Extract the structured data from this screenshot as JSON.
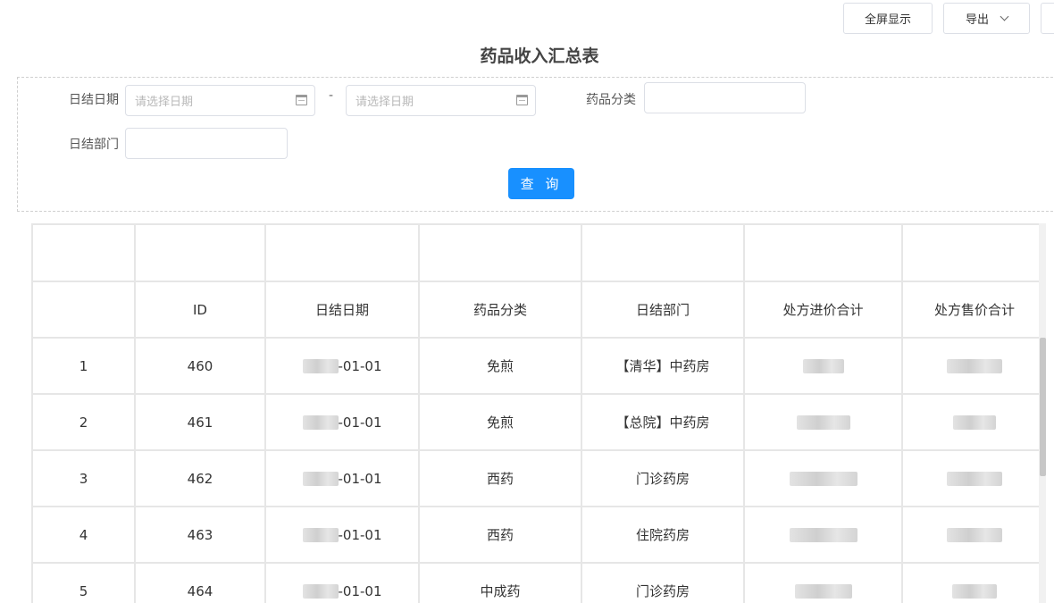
{
  "toolbar": {
    "fullscreen_label": "全屏显示",
    "export_label": "导出"
  },
  "title": "药品收入汇总表",
  "filters": {
    "date_label": "日结日期",
    "date_start_placeholder": "请选择日期",
    "date_sep": "-",
    "date_end_placeholder": "请选择日期",
    "category_label": "药品分类",
    "category_value": "",
    "dept_label": "日结部门",
    "dept_value": "",
    "query_label": "查 询"
  },
  "table": {
    "columns": [
      "",
      "ID",
      "日结日期",
      "药品分类",
      "日结部门",
      "处方进价合计",
      "处方售价合计"
    ],
    "rows": [
      {
        "index": "1",
        "id": "460",
        "date_suffix": "-01-01",
        "category": "免煎",
        "dept": "【清华】中药房"
      },
      {
        "index": "2",
        "id": "461",
        "date_suffix": "-01-01",
        "category": "免煎",
        "dept": "【总院】中药房"
      },
      {
        "index": "3",
        "id": "462",
        "date_suffix": "-01-01",
        "category": "西药",
        "dept": "门诊药房"
      },
      {
        "index": "4",
        "id": "463",
        "date_suffix": "-01-01",
        "category": "西药",
        "dept": "住院药房"
      },
      {
        "index": "5",
        "id": "464",
        "date_suffix": "-01-01",
        "category": "中成药",
        "dept": "门诊药房"
      }
    ]
  }
}
